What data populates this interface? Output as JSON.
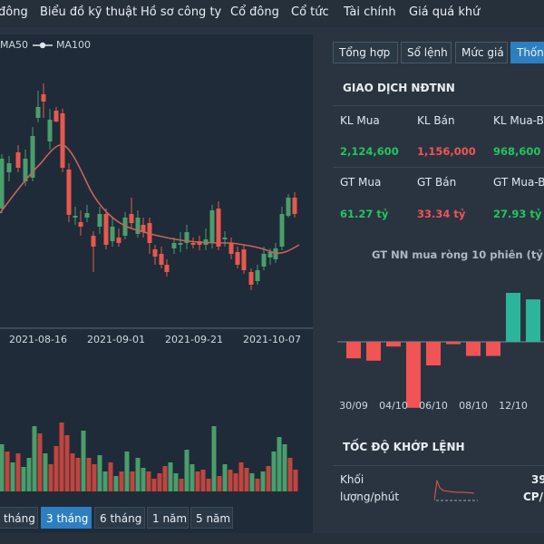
{
  "nav": {
    "items": [
      "đông",
      "Biểu đồ kỹ thuật",
      "Hồ sơ công ty",
      "Cổ đông",
      "Cổ tức",
      "Tài chính",
      "Giá quá khứ"
    ]
  },
  "legend": {
    "ma50": "MA50",
    "ma100": "MA100"
  },
  "chart_data": {
    "type": "candlestick",
    "x_tick_labels": [
      "2021-08-16",
      "2021-09-01",
      "2021-09-21",
      "2021-10-07"
    ],
    "series_names": [
      "MA50",
      "MA100"
    ],
    "colors": {
      "up": "#4a9e6b",
      "down": "#e8584f",
      "ma_line": "#c9635c",
      "volume_up": "#4a9e6b",
      "volume_down": "#c0453f"
    }
  },
  "range_buttons": [
    "tháng",
    "3 tháng",
    "6 tháng",
    "1 năm",
    "5 năm"
  ],
  "range_active": "3 tháng",
  "tabs": [
    "Tổng hợp",
    "Sổ lệnh",
    "Mức giá",
    "Thống"
  ],
  "tab_active": "Thống",
  "foreign": {
    "title": "GIAO DỊCH NĐTNN",
    "kl_mua_label": "KL Mua",
    "kl_ban_label": "KL Bán",
    "kl_net_label": "KL Mua-B",
    "kl_mua": "2,124,600",
    "kl_ban": "1,156,000",
    "kl_net": "968,600",
    "gt_mua_label": "GT Mua",
    "gt_ban_label": "GT Bán",
    "gt_net_label": "GT Mua-B",
    "gt_mua": "61.27 tỷ",
    "gt_ban": "33.34 tỷ",
    "gt_net": "27.93 tỷ"
  },
  "net_chart": {
    "title": "GT NN mua ròng 10 phiên (tỷ)",
    "type": "bar",
    "x_tick_labels": [
      "30/09",
      "04/10",
      "06/10",
      "08/10",
      "12/10"
    ],
    "values": [
      -7,
      -8,
      -2,
      -28,
      -10,
      -1,
      -6,
      -6,
      22,
      18
    ],
    "colors": {
      "positive": "#2bb59a",
      "negative": "#f05454"
    }
  },
  "speed": {
    "title": "TỐC ĐỘ KHỚP LỆNH",
    "label_line1": "Khối",
    "label_line2": "lượng/phút",
    "value": "39",
    "unit": "CP/"
  }
}
